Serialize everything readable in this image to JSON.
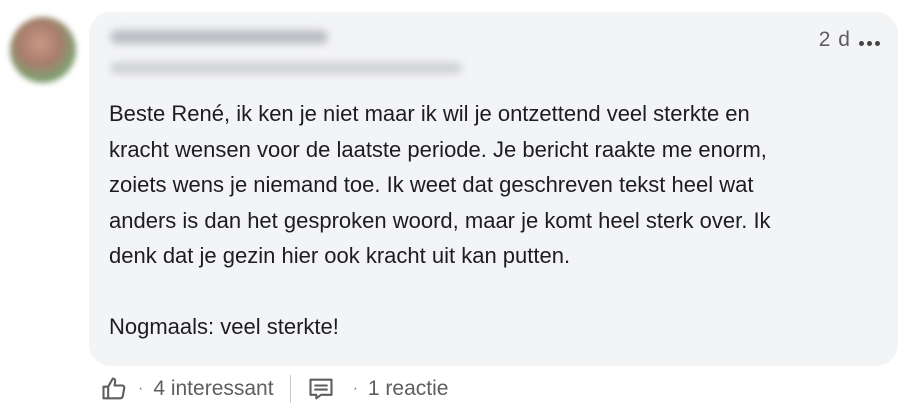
{
  "comment": {
    "timestamp": "2 d",
    "more_label": "...",
    "body": {
      "lines": [
        "Beste René, ik ken je niet maar ik wil je ontzettend veel sterkte en",
        "kracht wensen voor de laatste periode. Je bericht raakte me enorm,",
        "zoiets wens je niemand toe. Ik weet dat geschreven tekst heel wat",
        "anders is dan het gesproken woord, maar je komt heel sterk over. Ik",
        "denk dat je gezin hier ook kracht uit kan putten."
      ],
      "closing": "Nogmaals: veel sterkte!"
    }
  },
  "actions": {
    "reactions_label": "4 interessant",
    "replies_label": "1 reactie",
    "separator": "·",
    "icons": [
      "thumbs-up-icon",
      "comment-icon"
    ]
  },
  "colors": {
    "bubble_bg": "#f3f4f6",
    "text": "#1d1d1f",
    "muted": "#5e5e62"
  }
}
